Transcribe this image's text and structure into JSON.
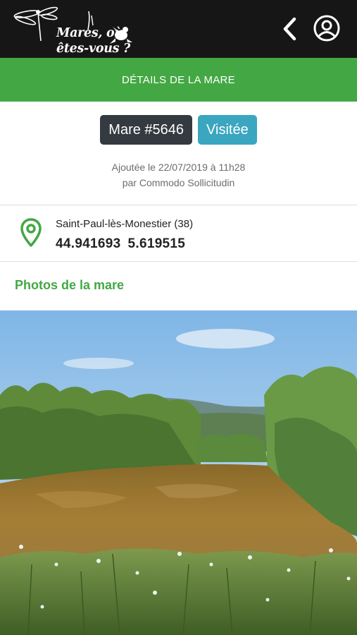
{
  "app": {
    "logo_text_line1": "Mares, où",
    "logo_text_line2": "êtes-vous ?"
  },
  "toolbar": {
    "back_icon": "chevron-left-icon",
    "account_icon": "user-circle-icon"
  },
  "page": {
    "title": "DÉTAILS DE LA MARE"
  },
  "mare": {
    "id_label": "Mare #5646",
    "status": "Visitée",
    "added_line": "Ajoutée le 22/07/2019 à 11h28",
    "author_line": "par Commodo Sollicitudin"
  },
  "location": {
    "icon": "map-pin-icon",
    "commune": "Saint-Paul-lès-Monestier (38)",
    "latitude": "44.941693",
    "longitude": "5.619515"
  },
  "photos": {
    "section_title": "Photos de la mare"
  },
  "colors": {
    "topbar": "#161616",
    "accent_green": "#43a843",
    "badge_dark": "#343a40",
    "badge_info": "#3aa6c0"
  }
}
